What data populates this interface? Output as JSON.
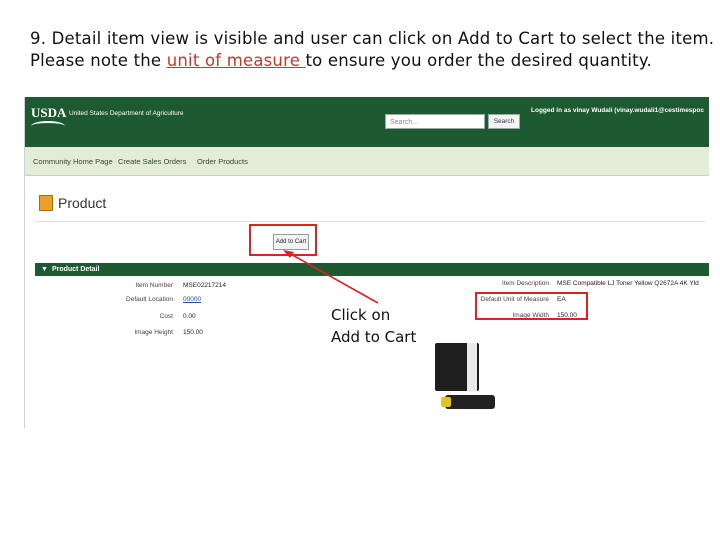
{
  "caption": {
    "line1": "9. Detail item view is visible and user can click on Add to Cart to select the item.",
    "line2_prefix": "Please note the ",
    "line2_highlight": "unit of measure ",
    "line2_suffix": "to ensure you order the desired quantity."
  },
  "header": {
    "logo_text": "USDA",
    "agency_name": "United States Department of Agriculture",
    "search_placeholder": "Search...",
    "search_button": "Search",
    "logged_in": "Logged in as vinay Wudali (vinay.wudali1@cestimespoc"
  },
  "nav": {
    "items": [
      "Community Home Page",
      "Create Sales Orders",
      "Order Products"
    ]
  },
  "page": {
    "title": "Product",
    "add_to_cart": "Add to Cart"
  },
  "detail": {
    "section_title": "Product Detail",
    "section_toggle": "▼",
    "item_number_label": "Item Number",
    "item_number": "MSE02217214",
    "default_location_label": "Default Location",
    "default_location": "00000",
    "cost_label": "Cost",
    "cost": "0.00",
    "image_height_label": "Image Height",
    "image_height": "150.00",
    "item_description_label": "Item Description",
    "item_description": "MSE Compatible LJ Toner Yellow Q2672A 4K Yld",
    "unit_of_measure_label": "Default Unit of Measure",
    "unit_of_measure": "EA",
    "image_width_label": "Image Width",
    "image_width": "150.00"
  },
  "annotation": {
    "line1": "Click on",
    "line2": "Add to Cart"
  },
  "colors": {
    "usda_green": "#1d5a31",
    "highlight_red": "#d22222"
  }
}
